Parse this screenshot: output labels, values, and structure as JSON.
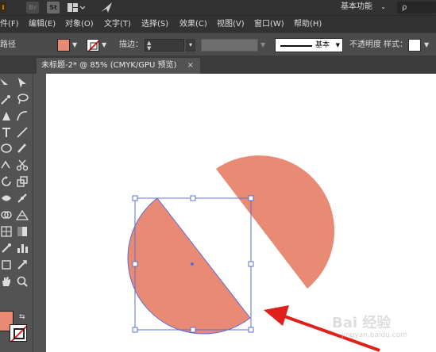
{
  "app": {
    "logo_text": "i",
    "bridge_text": "Br",
    "stock_text": "St",
    "workspace_label": "基本功能",
    "search_placeholder": "ρ"
  },
  "menu": [
    "件(F)",
    "编辑(E)",
    "对象(O)",
    "文字(T)",
    "选择(S)",
    "效果(C)",
    "视图(V)",
    "窗口(W)",
    "帮助(H)"
  ],
  "control": {
    "selection_label": "路径",
    "fill_color": "#e88a74",
    "stroke_label": "描边：",
    "brush_label": "基本",
    "opacity_label": "不透明度",
    "style_label": "样式："
  },
  "document_tab": {
    "title": "未标题-2* @ 85% (CMYK/GPU 预览)",
    "close": "×"
  },
  "canvas": {
    "shape_color": "#e88a74",
    "selection_color": "#5b6fd6",
    "arrow_color": "#e0201a"
  },
  "watermark": {
    "brand": "Bai 经验",
    "url": "jingyan.baidu.com"
  }
}
